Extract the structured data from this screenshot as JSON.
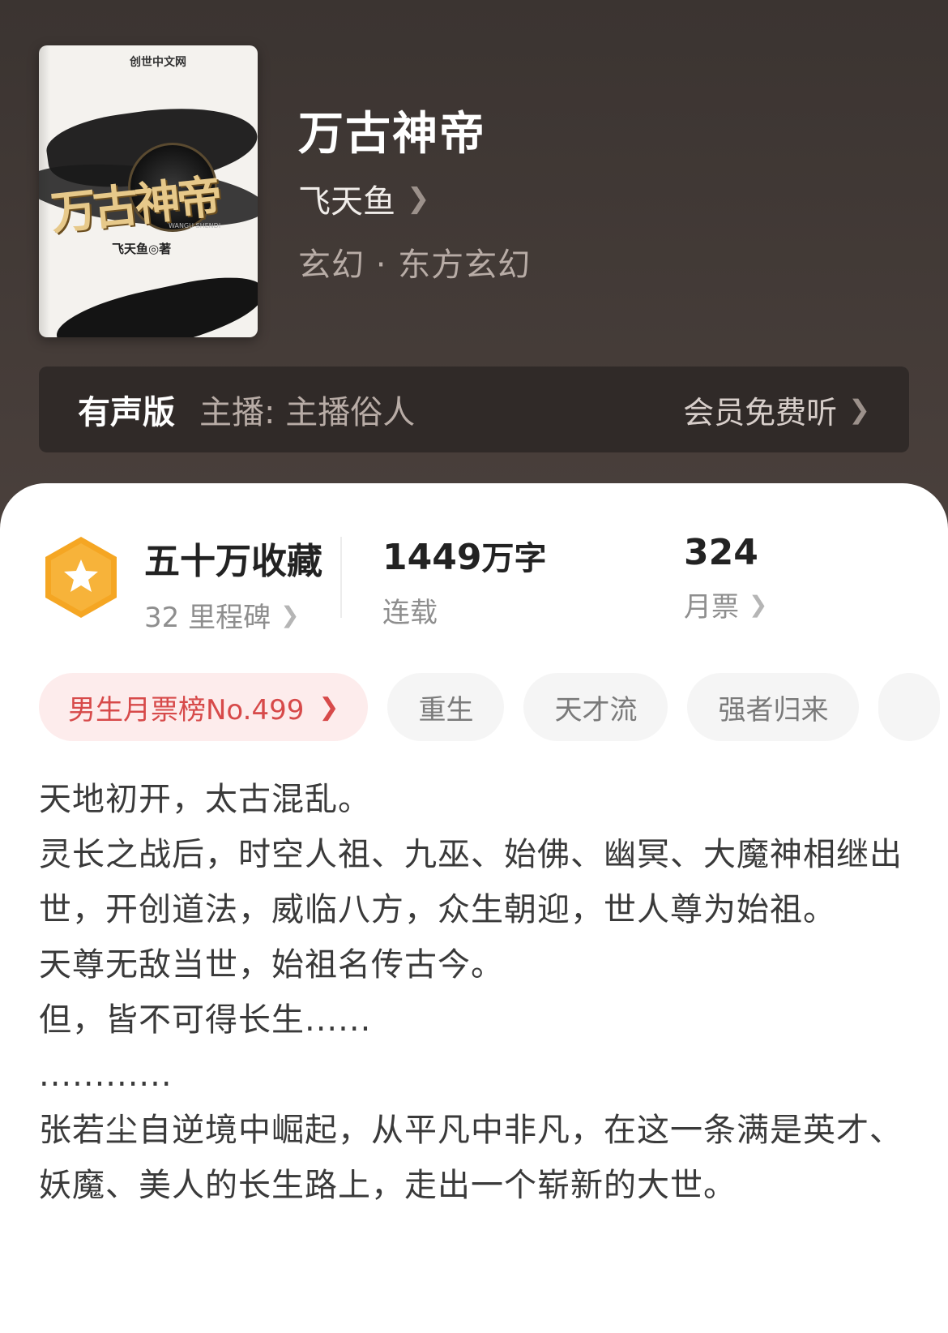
{
  "book": {
    "cover": {
      "title_art": "万古神帝",
      "publisher_logo": "创世中文网",
      "pinyin": "WANGU SHENDI",
      "author_mark": "飞天鱼◎著"
    },
    "title": "万古神帝",
    "author": "飞天鱼",
    "genre": "玄幻 · 东方玄幻"
  },
  "audio": {
    "label": "有声版",
    "anchor": "主播:  主播俗人",
    "action": "会员免费听"
  },
  "stats": {
    "collect_title": "五十万收藏",
    "collect_sub": "32 里程碑",
    "words_num": "1449",
    "words_unit": "万字",
    "words_sub": "连载",
    "tickets_num": "324",
    "tickets_sub": "月票"
  },
  "tags": [
    {
      "label": "男生月票榜No.499"
    },
    {
      "label": "重生"
    },
    {
      "label": "天才流"
    },
    {
      "label": "强者归来"
    }
  ],
  "description": [
    "天地初开，太古混乱。",
    "灵长之战后，时空人祖、九巫、始佛、幽冥、大魔神相继出世，开创道法，威临八方，众生朝迎，世人尊为始祖。",
    "天尊无敌当世，始祖名传古今。",
    "但，皆不可得长生......",
    "............",
    "张若尘自逆境中崛起，从平凡中非凡，在这一条满是英才、妖魔、美人的长生路上，走出一个崭新的大世。"
  ],
  "colors": {
    "badge": "#f5a623",
    "rank_tag_bg": "#fdecec",
    "rank_tag_text": "#d74a4a"
  }
}
